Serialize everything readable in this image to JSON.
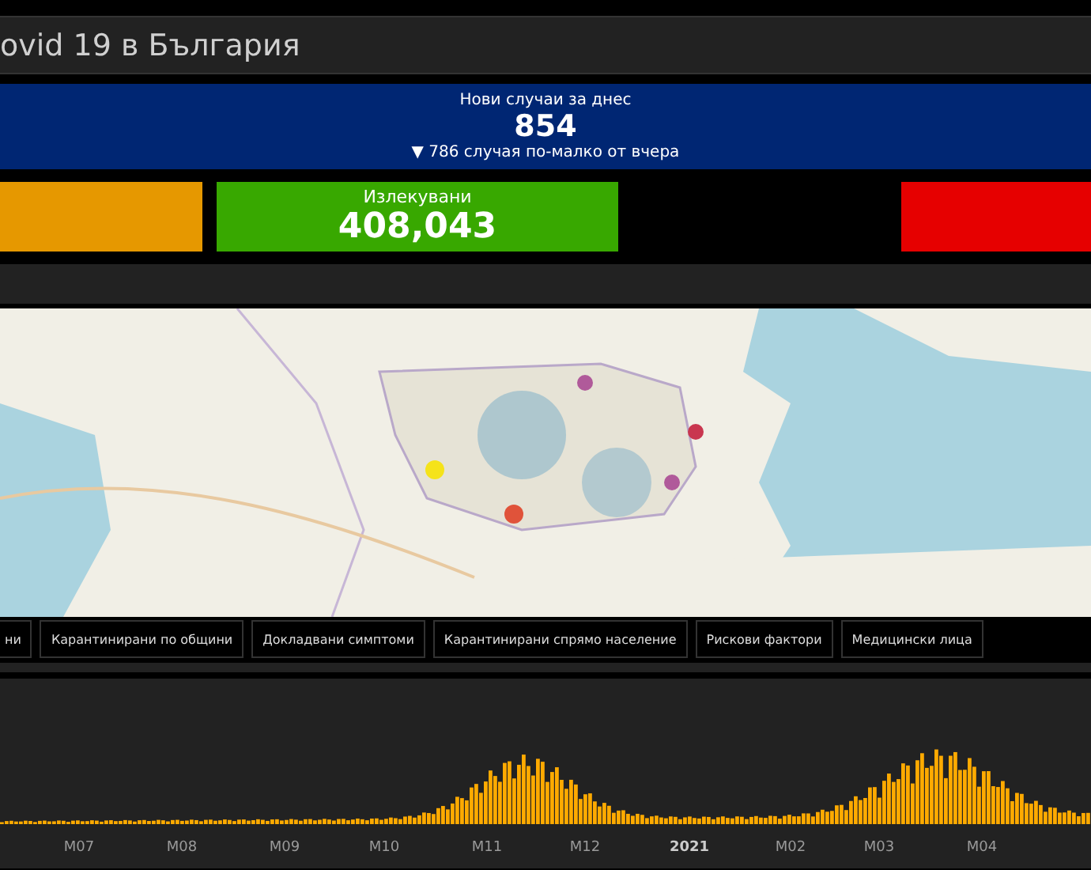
{
  "header": {
    "title": "ovid 19 в България"
  },
  "today": {
    "label": "Нови случаи за днес",
    "value": "854",
    "change": "▼ 786 случая по-малко от вчера"
  },
  "cards": [
    {
      "kind": "blank",
      "color": "#e69800"
    },
    {
      "kind": "stat",
      "color": "#38a800",
      "label": "Излекувани",
      "value": "408,043"
    },
    {
      "kind": "blank",
      "color": "#e60000"
    }
  ],
  "tabs": [
    "ни",
    "Карантинирани по общини",
    "Докладвани симптоми",
    "Карантинирани спрямо население",
    "Рискови фактори",
    "Медицински лица"
  ],
  "chart": {
    "x_labels": [
      {
        "label": "M07",
        "bold": false
      },
      {
        "label": "M08",
        "bold": false
      },
      {
        "label": "M09",
        "bold": false
      },
      {
        "label": "M10",
        "bold": false
      },
      {
        "label": "M11",
        "bold": false
      },
      {
        "label": "M12",
        "bold": false
      },
      {
        "label": "2021",
        "bold": true
      },
      {
        "label": "M02",
        "bold": false
      },
      {
        "label": "M03",
        "bold": false
      },
      {
        "label": "M04",
        "bold": false
      }
    ]
  }
}
